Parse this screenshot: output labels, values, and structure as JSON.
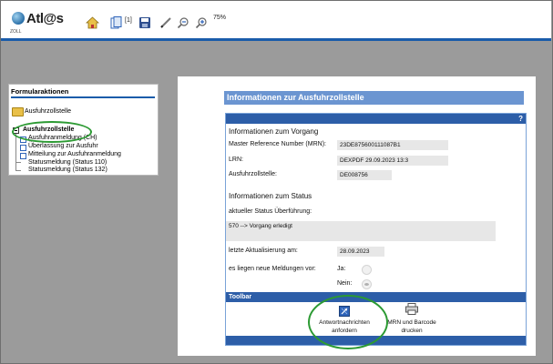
{
  "topbar": {
    "logo_text": "Atl@s",
    "logo_sub": "ZOLL",
    "page_count": "[1]",
    "zoom": "75%",
    "icons": [
      "home-icon",
      "pages-icon",
      "save-icon",
      "pen-icon",
      "zoom-out-icon",
      "zoom-in-icon"
    ]
  },
  "sidebar": {
    "title": "Formularaktionen",
    "folder_label": "Ausfuhrzollstelle",
    "tree": {
      "root": "Ausfuhrzollstelle",
      "items": [
        "Ausfuhranmeldung (CH)",
        "Überlassung zur Ausfuhr",
        "Mitteilung zur Ausfuhranmeldung",
        "Statusmeldung (Status 110)",
        "Statusmeldung (Status 132)"
      ]
    }
  },
  "form": {
    "header": "Informationen zur Ausfuhrzollstelle",
    "help": "?",
    "section_vorgang": "Informationen zum Vorgang",
    "mrn_label": "Master Reference Number (MRN):",
    "mrn_value": "23DE875600111087B1",
    "lrn_label": "LRN:",
    "lrn_value": "DEXPDF 29.09.2023 13:3",
    "zollstelle_label": "Ausfuhrzollstelle:",
    "zollstelle_value": "DE008756",
    "section_status": "Informationen zum Status",
    "status_label": "aktueller Status Überführung:",
    "status_value": "570 --> Vorgang erledigt",
    "update_label": "letzte Aktualisierung am:",
    "update_value": "28.09.2023",
    "new_msgs_label": "es liegen neue Meldungen vor:",
    "ja": "Ja:",
    "nein": "Nein:",
    "toolbar_title": "Toolbar",
    "btn_request": [
      "Antwortnachrichten",
      "anfordern"
    ],
    "btn_print": [
      "MRN und Barcode",
      "drucken"
    ]
  }
}
